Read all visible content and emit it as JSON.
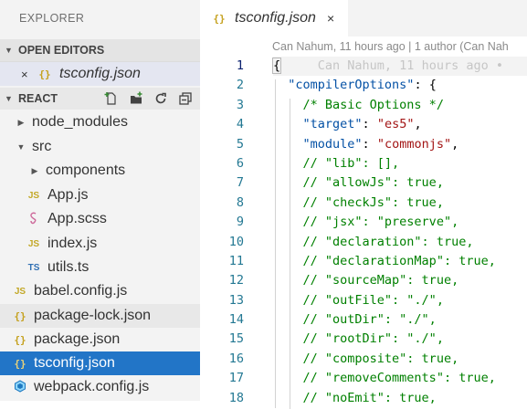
{
  "sidebar": {
    "title": "EXPLORER",
    "open_editors": {
      "label": "OPEN EDITORS",
      "items": [
        {
          "close": "×",
          "name": "tsconfig.json"
        }
      ]
    },
    "project": {
      "label": "REACT",
      "actions": [
        "new-file-icon",
        "new-folder-icon",
        "refresh-icon",
        "collapse-all-icon"
      ]
    },
    "tree": [
      {
        "name": "node_modules",
        "type": "folder",
        "open": false,
        "depth": 1
      },
      {
        "name": "src",
        "type": "folder",
        "open": true,
        "depth": 1
      },
      {
        "name": "components",
        "type": "folder",
        "open": false,
        "depth": 2
      },
      {
        "name": "App.js",
        "type": "js",
        "badge": "JS",
        "depth": 2
      },
      {
        "name": "App.scss",
        "type": "scss",
        "depth": 2
      },
      {
        "name": "index.js",
        "type": "js",
        "badge": "JS",
        "depth": 2
      },
      {
        "name": "utils.ts",
        "type": "ts",
        "badge": "TS",
        "depth": 2
      },
      {
        "name": "babel.config.js",
        "type": "js",
        "badge": "JS",
        "depth": 0
      },
      {
        "name": "package-lock.json",
        "type": "json",
        "depth": 0
      },
      {
        "name": "package.json",
        "type": "json",
        "depth": 0
      },
      {
        "name": "tsconfig.json",
        "type": "json",
        "depth": 0
      },
      {
        "name": "webpack.config.js",
        "type": "webpack",
        "depth": 0
      }
    ]
  },
  "editor": {
    "tab": {
      "name": "tsconfig.json",
      "close": "×",
      "icon": "{ }"
    },
    "blame_header": "Can Nahum, 11 hours ago | 1 author (Can Nah",
    "inline_blame": "Can Nahum, 11 hours ago •",
    "line_numbers": [
      "1",
      "2",
      "3",
      "4",
      "5",
      "6",
      "7",
      "8",
      "9",
      "10",
      "11",
      "12",
      "13",
      "14",
      "15",
      "16",
      "17",
      "18"
    ],
    "lines": [
      "{",
      "  \"compilerOptions\": {",
      "    /* Basic Options */",
      "    \"target\": \"es5\",",
      "    \"module\": \"commonjs\",",
      "    // \"lib\": [],",
      "    // \"allowJs\": true,",
      "    // \"checkJs\": true,",
      "    // \"jsx\": \"preserve\",",
      "    // \"declaration\": true,",
      "    // \"declarationMap\": true,",
      "    // \"sourceMap\": true,",
      "    // \"outFile\": \"./\",",
      "    // \"outDir\": \"./\",",
      "    // \"rootDir\": \"./\",",
      "    // \"composite\": true,",
      "    // \"removeComments\": true,",
      "    // \"noEmit\": true,"
    ]
  },
  "colors": {
    "selection": "#2275c7",
    "key": "#0451a5",
    "string": "#a31515",
    "comment": "#008000",
    "line_number": "#237893"
  }
}
